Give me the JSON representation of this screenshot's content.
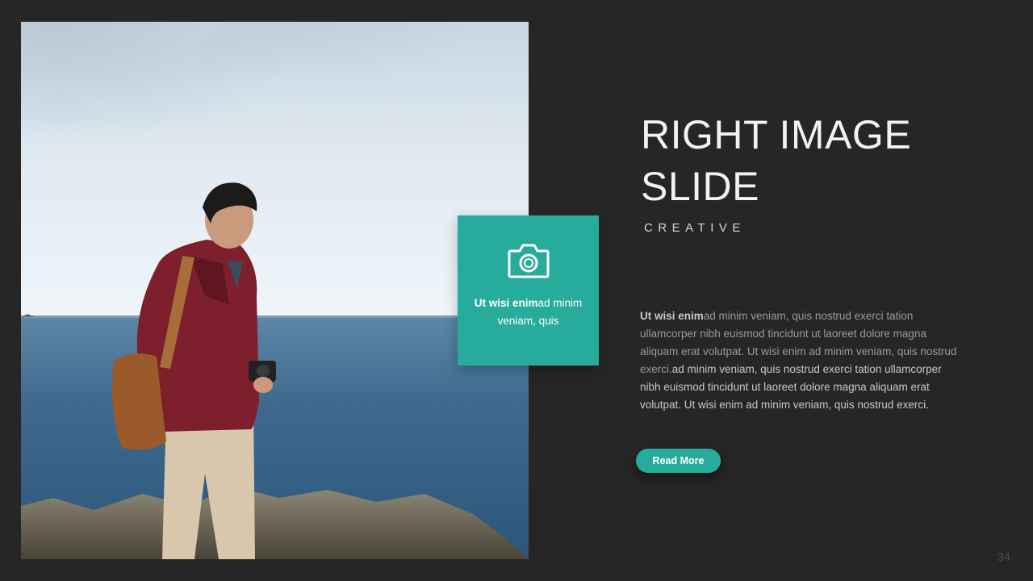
{
  "slide": {
    "title_line1": "RIGHT IMAGE",
    "title_line2": "SLIDE",
    "subtitle": "CREATIVE",
    "page_number": "34",
    "accent_color": "#27ab9c",
    "background_color": "#262626"
  },
  "photo": {
    "icon": "photo-of-man-with-camera-by-sea"
  },
  "card": {
    "icon": "camera-icon",
    "text_bold": "Ut wisi enim",
    "text_rest": "ad minim veniam, quis"
  },
  "body": {
    "lead_bold": "Ut wisi enim",
    "part1": "ad minim veniam, quis nostrud exerci tation ullamcorper nibh euismod tincidunt ut laoreet dolore magna aliquam erat volutpat. Ut wisi enim ad minim veniam, quis nostrud exerci.",
    "part2": "ad minim veniam, quis nostrud exerci tation ullamcorper nibh euismod tincidunt ut laoreet dolore magna aliquam erat volutpat. Ut wisi enim ad minim veniam, quis nostrud exerci."
  },
  "button": {
    "label": "Read More"
  }
}
